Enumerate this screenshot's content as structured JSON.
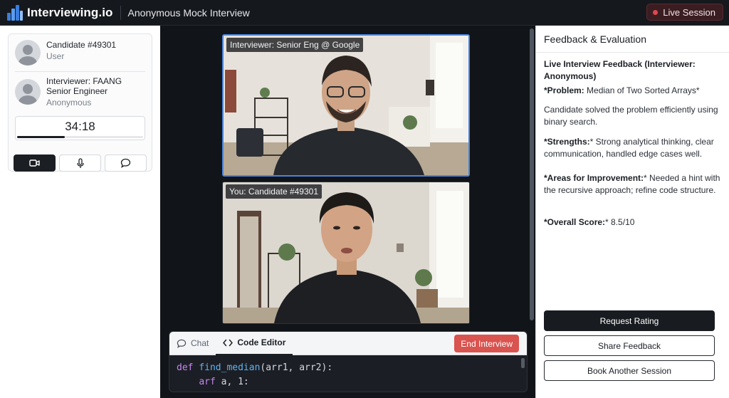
{
  "header": {
    "brand": "Interviewing.io",
    "title": "Anonymous Mock Interview",
    "live_label": "Live Session"
  },
  "participants": {
    "candidate": {
      "name": "Candidate #49301",
      "role": "User"
    },
    "interviewer": {
      "name_line1": "Interviewer: FAANG",
      "name_line2": "Senior Engineer",
      "role": "Anonymous"
    }
  },
  "timer": {
    "value": "34:18",
    "progress": 0.38
  },
  "controls": {
    "icons": [
      "video-icon",
      "mic-icon",
      "chat-bubble-icon"
    ],
    "active": "video-icon"
  },
  "video": {
    "interviewer_label": "Interviewer: Senior Eng @ Google",
    "candidate_label": "You: Candidate #49301"
  },
  "editor": {
    "tab_chat": "Chat",
    "tab_code": "Code Editor",
    "end_button": "End Interview",
    "code_line1_kw": "def",
    "code_line1_fn": "find_median",
    "code_line1_rest": "(arr1, arr2):",
    "code_line2_kw": "arf",
    "code_line2_rest": " a, 1:"
  },
  "feedback": {
    "title": "Feedback & Evaluation",
    "heading": "Live Interview Feedback (Interviewer: Anonymous)",
    "problem_label": "*Problem:",
    "problem_value": " Median of Two Sorted Arrays*",
    "summary": "Candidate solved the problem efficiently using binary search.",
    "strengths_label": "*Strengths:",
    "strengths_value": "* Strong analytical thinking, clear communication, handled edge cases well.",
    "improve_label": "*Areas for Improvement:",
    "improve_value": "* Needed a hint with the recursive approach; refine code structure.",
    "score_label": "*Overall Score:",
    "score_value": "* 8.5/10"
  },
  "actions": {
    "request_rating": "Request Rating",
    "share_feedback": "Share Feedback",
    "book_session": "Book Another Session"
  },
  "colors": {
    "accent_red": "#d9534f",
    "live_dot": "#e0474e",
    "video_highlight": "#4d84d8"
  }
}
